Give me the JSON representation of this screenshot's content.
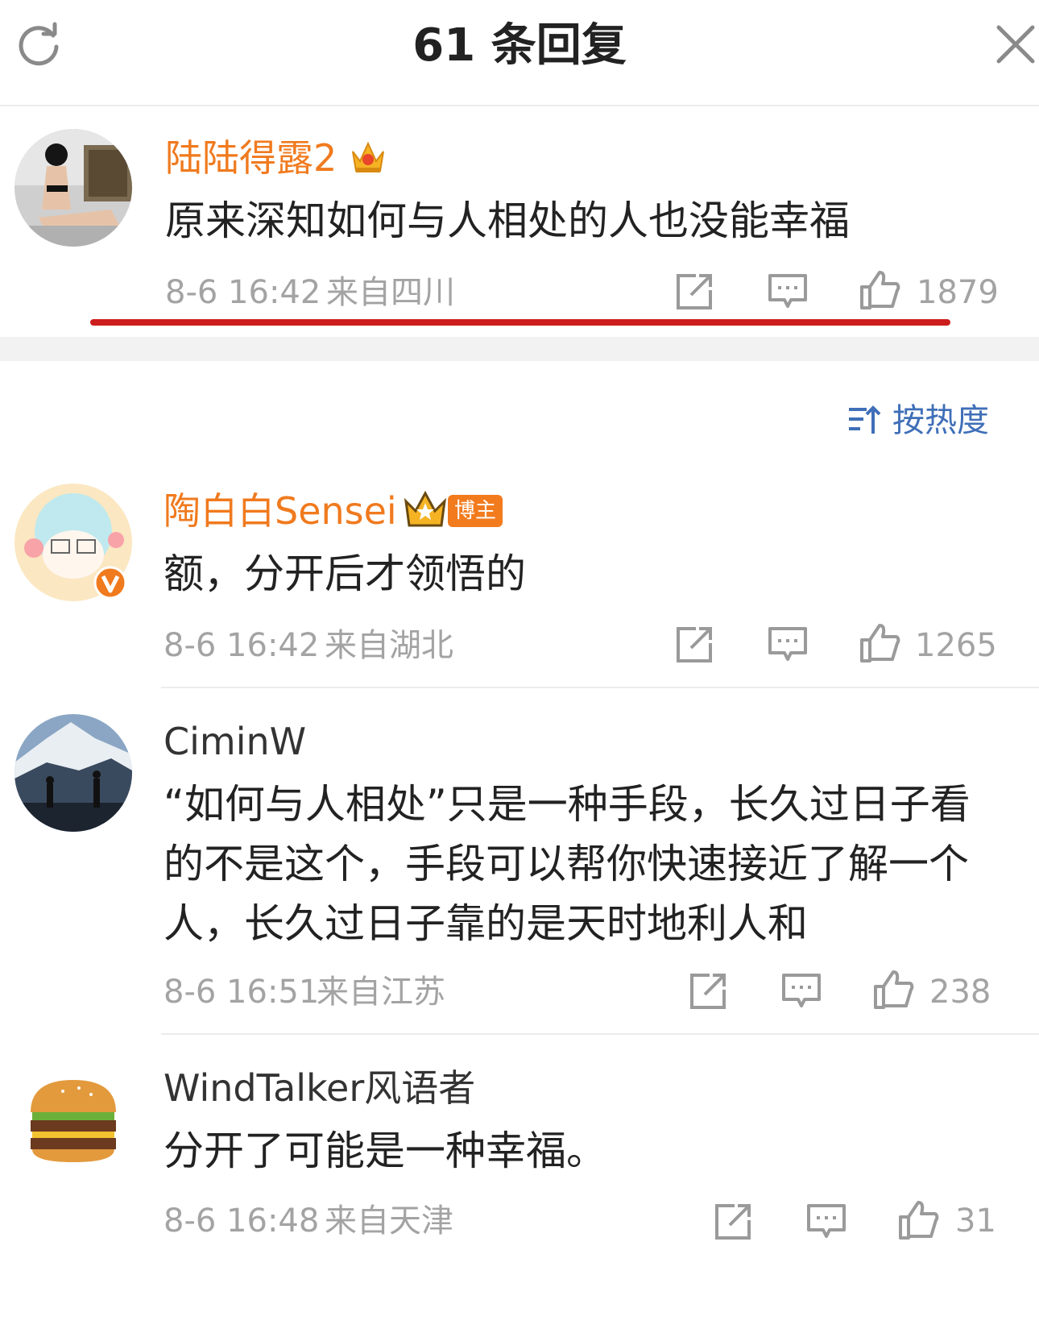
{
  "header": {
    "title": "61 条回复"
  },
  "icons": {
    "refresh": "refresh-icon",
    "close": "close-icon",
    "share": "share-icon",
    "comment": "comment-icon",
    "like": "thumbs-up-icon",
    "sort": "sort-icon",
    "verified": "verified-badge-icon",
    "crown": "crown-icon"
  },
  "colors": {
    "vip_name": "#f07a1e",
    "sort_link": "#3f6fb8",
    "highlight_line": "#cc1d1d",
    "meta": "#a3a3a3"
  },
  "main_comment": {
    "user": "陆陆得露2",
    "text": "原来深知如何与人相处的人也没能幸福",
    "time": "8-6 16:42",
    "location": "来自四川",
    "likes": "1879"
  },
  "sort": {
    "label": "按热度"
  },
  "replies": [
    {
      "user": "陶白白Sensei",
      "badge": "博主",
      "text": "额，分开后才领悟的",
      "time": "8-6 16:42",
      "location": "来自湖北",
      "likes": "1265"
    },
    {
      "user": "CiminW",
      "text_lines": [
        "“如何与人相处”只是一种手段，长久过日子看",
        "的不是这个，手段可以帮你快速接近了解一个",
        "人，长久过日子靠的是天时地利人和"
      ],
      "time": "8-6 16:51",
      "location": "来自江苏",
      "likes": "238"
    },
    {
      "user": "WindTalker风语者",
      "text": "分开了可能是一种幸福。",
      "time": "8-6 16:48",
      "location": "来自天津",
      "likes": "31"
    }
  ]
}
